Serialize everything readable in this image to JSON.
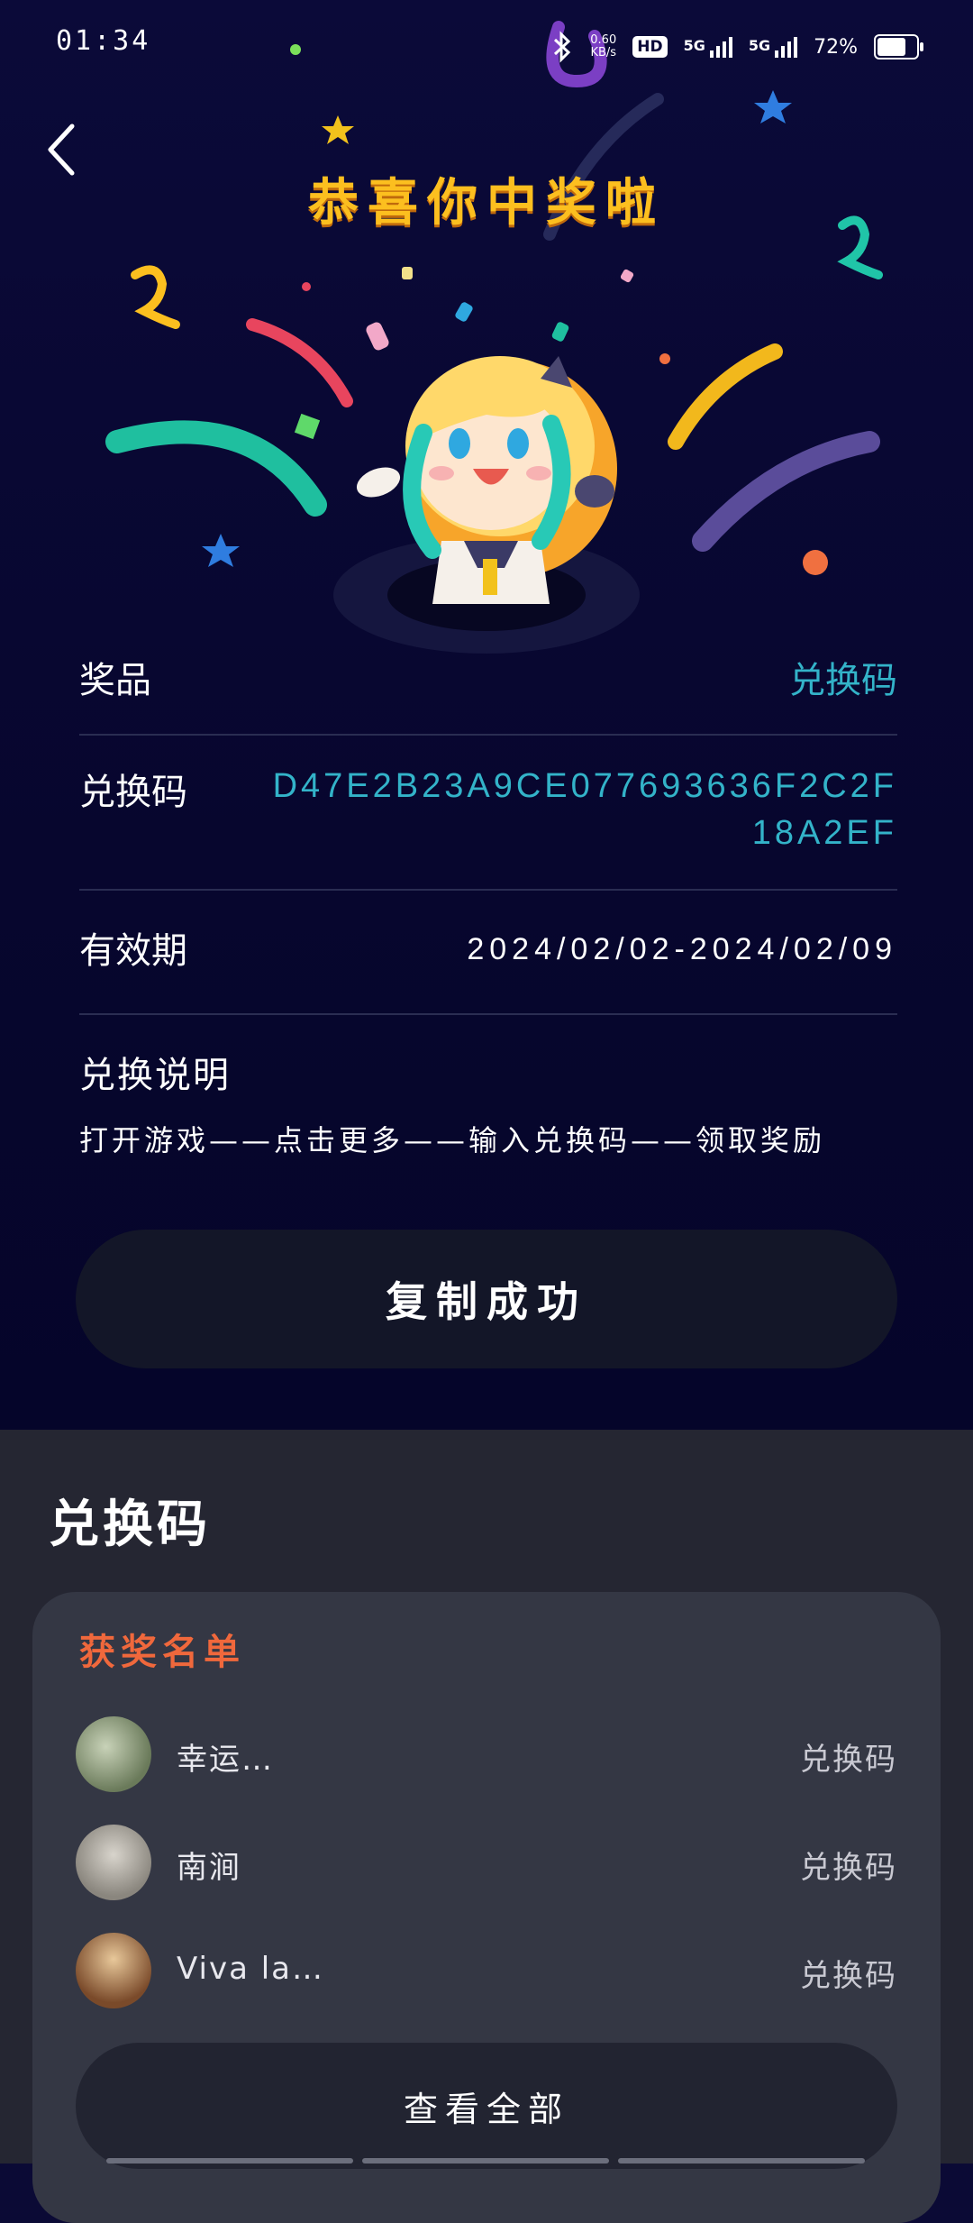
{
  "status_bar": {
    "time": "01:34",
    "net_speed_value": "0.60",
    "net_speed_unit": "KB/s",
    "hd_badge": "HD",
    "sim1_label": "5G",
    "sim2_label": "5G",
    "battery_percent": "72%"
  },
  "header": {
    "title": "恭喜你中奖啦"
  },
  "prize_info": {
    "prize_label": "奖品",
    "prize_value": "兑换码",
    "code_label": "兑换码",
    "code_value": "D47E2B23A9CE077693636F2C2F18A2EF",
    "validity_label": "有效期",
    "validity_value": "2024/02/02-2024/02/09",
    "instructions_label": "兑换说明",
    "instructions_text": "打开游戏——点击更多——输入兑换码——领取奖励"
  },
  "copy_button": {
    "label": "复制成功"
  },
  "lower_section": {
    "title": "兑换码",
    "winners_title": "获奖名单",
    "winners": [
      {
        "name": "幸运…",
        "prize": "兑换码",
        "avatar_color": "#8a9a7a"
      },
      {
        "name": "南涧",
        "prize": "兑换码",
        "avatar_color": "#a8a49c"
      },
      {
        "name": "Viva la…",
        "prize": "兑换码",
        "avatar_color": "#8a5a3a"
      }
    ],
    "view_all_label": "查看全部"
  },
  "colors": {
    "accent_title": "#fcbf1f",
    "code_color": "#33b3c9",
    "winners_header": "#f0683c"
  }
}
